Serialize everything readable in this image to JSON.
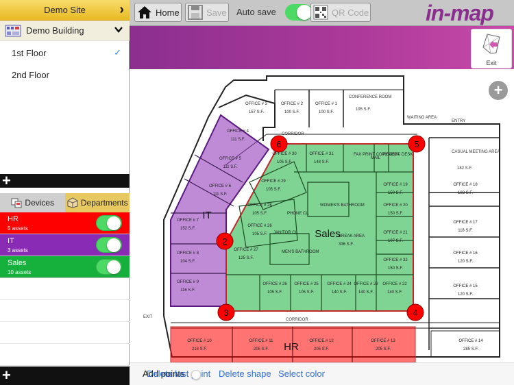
{
  "sidebar": {
    "site": "Demo Site",
    "building": "Demo Building",
    "floors": [
      {
        "label": "1st Floor",
        "selected": true
      },
      {
        "label": "2nd Floor",
        "selected": false
      }
    ],
    "tabs": [
      {
        "label": "Devices",
        "active": false
      },
      {
        "label": "Departments",
        "active": true
      }
    ],
    "groups": [
      {
        "name": "HR",
        "assets": "5 assets",
        "color": "#ff0000",
        "visible": true
      },
      {
        "name": "IT",
        "assets": "3 assets",
        "color": "#8a2bb6",
        "visible": true
      },
      {
        "name": "Sales",
        "assets": "10 assets",
        "color": "#16b03c",
        "visible": true
      }
    ]
  },
  "toolbar": {
    "home_label": "Home",
    "save_label": "Save",
    "autosave_label": "Auto save",
    "autosave_on": true,
    "qr_label": "QR Code",
    "logo_text": "in-map"
  },
  "banner": {
    "exit_label": "Exit"
  },
  "map": {
    "zone_labels": {
      "it": "IT",
      "sales": "Sales",
      "hr": "HR"
    },
    "vertices": [
      "1",
      "2",
      "3",
      "4",
      "5",
      "6"
    ],
    "plan_labels": {
      "corridor": "CORRIDOR",
      "waiting_area": "WAITING AREA",
      "entry": "ENTRY",
      "exit": "EXIT",
      "conference_room": "CONFERENCE ROOM",
      "casual_meeting_area": "CASUAL MEETING AREA",
      "break_area": "BREAK AREA",
      "mail": "MAIL",
      "reception_desk": "RECEPT. DESK",
      "fax_print_copy": "FAX PRINT COPY AREA",
      "womens_bathroom": "WOMEN'S BATHROOM",
      "mens_bathroom": "MEN'S BATHROOM",
      "janitor": "JANITOR CL.",
      "phone": "PHONE CL."
    },
    "offices": [
      {
        "label": "OFFICE # 3",
        "area": "157 S.F."
      },
      {
        "label": "OFFICE # 2",
        "area": "100 S.F."
      },
      {
        "label": "OFFICE # 1",
        "area": "100 S.F."
      },
      {
        "label": "OFFICE # 4",
        "area": "111 S.F."
      },
      {
        "label": "OFFICE # 5",
        "area": "111 S.F."
      },
      {
        "label": "OFFICE # 6",
        "area": "111 S.F."
      },
      {
        "label": "OFFICE # 7",
        "area": "152 S.F."
      },
      {
        "label": "OFFICE # 8",
        "area": "104 S.F."
      },
      {
        "label": "OFFICE # 9",
        "area": "116 S.F."
      },
      {
        "label": "OFFICE # 30",
        "area": "105 S.F."
      },
      {
        "label": "OFFICE # 31",
        "area": "148 S.F."
      },
      {
        "label": "OFFICE # 29",
        "area": "105 S.F."
      },
      {
        "label": "OFFICE # 28",
        "area": "105 S.F."
      },
      {
        "label": "OFFICE # 26",
        "area": "105 S.F."
      },
      {
        "label": "OFFICE # 27",
        "area": "125 S.F."
      },
      {
        "label": "OFFICE # 26",
        "area": "105 S.F."
      },
      {
        "label": "OFFICE # 25",
        "area": "105 S.F."
      },
      {
        "label": "OFFICE # 24",
        "area": "140 S.F."
      },
      {
        "label": "OFFICE # 23",
        "area": "140 S.F."
      },
      {
        "label": "OFFICE # 22",
        "area": "140 S.F."
      },
      {
        "label": "OFFICE # 19",
        "area": "150 S.F."
      },
      {
        "label": "OFFICE # 20",
        "area": "150 S.F."
      },
      {
        "label": "OFFICE # 21",
        "area": "107 S.F."
      },
      {
        "label": "OFFICE # 32",
        "area": "150 S.F."
      },
      {
        "label": "OFFICE # 18",
        "area": "183 S.F."
      },
      {
        "label": "OFFICE # 17",
        "area": "118 S.F."
      },
      {
        "label": "OFFICE # 16",
        "area": "120 S.F."
      },
      {
        "label": "OFFICE # 15",
        "area": "120 S.F."
      },
      {
        "label": "OFFICE # 14",
        "area": "285 S.F."
      },
      {
        "label": "OFFICE # 10",
        "area": "218 S.F."
      },
      {
        "label": "OFFICE # 11",
        "area": "205 S.F."
      },
      {
        "label": "OFFICE # 12",
        "area": "205 S.F."
      },
      {
        "label": "OFFICE # 13",
        "area": "205 S.F."
      }
    ],
    "sized_rooms": [
      {
        "label": "CONFERENCE ROOM",
        "area": "195 S.F."
      },
      {
        "label": "CASUAL MEETING AREA",
        "area": "182 S.F."
      },
      {
        "label": "BREAK AREA",
        "area": "336 S.F."
      }
    ]
  },
  "bottombar": {
    "add_points": "Add points",
    "delete_last_point": "Delete last point",
    "delete_shape": "Delete shape",
    "select_color": "Select color"
  }
}
